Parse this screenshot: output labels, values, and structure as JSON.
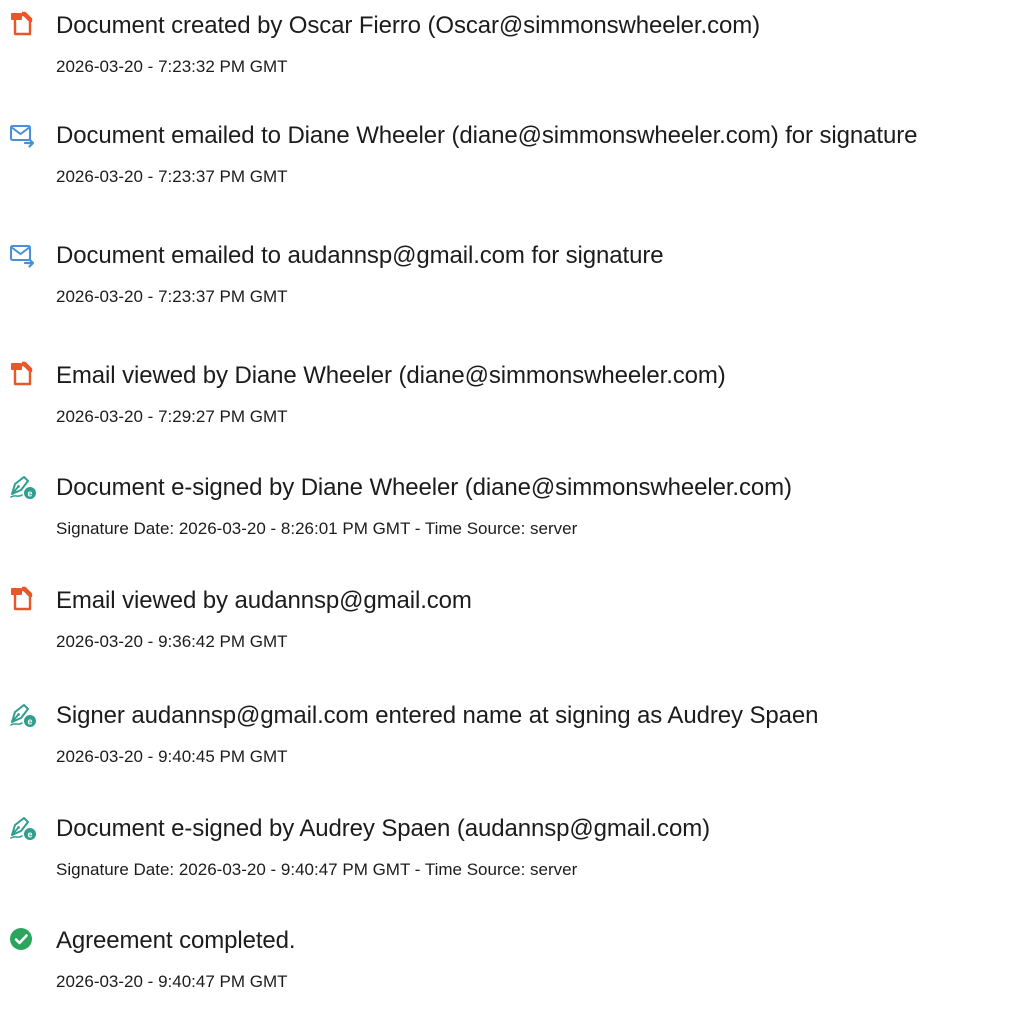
{
  "events": [
    {
      "icon": "document-icon",
      "title": "Document created by Oscar Fierro (Oscar@simmonswheeler.com)",
      "detail": "2026-03-20 - 7:23:32 PM GMT"
    },
    {
      "icon": "email-sent-icon",
      "title": "Document emailed to Diane Wheeler (diane@simmonswheeler.com) for signature",
      "detail": "2026-03-20 - 7:23:37 PM GMT"
    },
    {
      "icon": "email-sent-icon",
      "title": "Document emailed to audannsp@gmail.com for signature",
      "detail": "2026-03-20 - 7:23:37 PM GMT"
    },
    {
      "icon": "document-icon",
      "title": "Email viewed by Diane Wheeler (diane@simmonswheeler.com)",
      "detail": "2026-03-20 - 7:29:27 PM GMT"
    },
    {
      "icon": "e-sign-pen-icon",
      "title": "Document e-signed by Diane Wheeler (diane@simmonswheeler.com)",
      "detail": "Signature Date: 2026-03-20 - 8:26:01 PM GMT - Time Source: server"
    },
    {
      "icon": "document-icon",
      "title": "Email viewed by audannsp@gmail.com",
      "detail": "2026-03-20 - 9:36:42 PM GMT"
    },
    {
      "icon": "e-sign-pen-icon",
      "title": "Signer audannsp@gmail.com entered name at signing as Audrey Spaen",
      "detail": "2026-03-20 - 9:40:45 PM GMT"
    },
    {
      "icon": "e-sign-pen-icon",
      "title": "Document e-signed by Audrey Spaen (audannsp@gmail.com)",
      "detail": "Signature Date: 2026-03-20 - 9:40:47 PM GMT - Time Source: server"
    },
    {
      "icon": "check-circle-icon",
      "title": "Agreement completed.",
      "detail": "2026-03-20 - 9:40:47 PM GMT"
    }
  ],
  "colors": {
    "document_icon": "#e8562a",
    "email_icon": "#4a90d9",
    "sign_icon": "#2f9e8f",
    "check_icon": "#2aa65c",
    "text": "#1c1c1c"
  }
}
